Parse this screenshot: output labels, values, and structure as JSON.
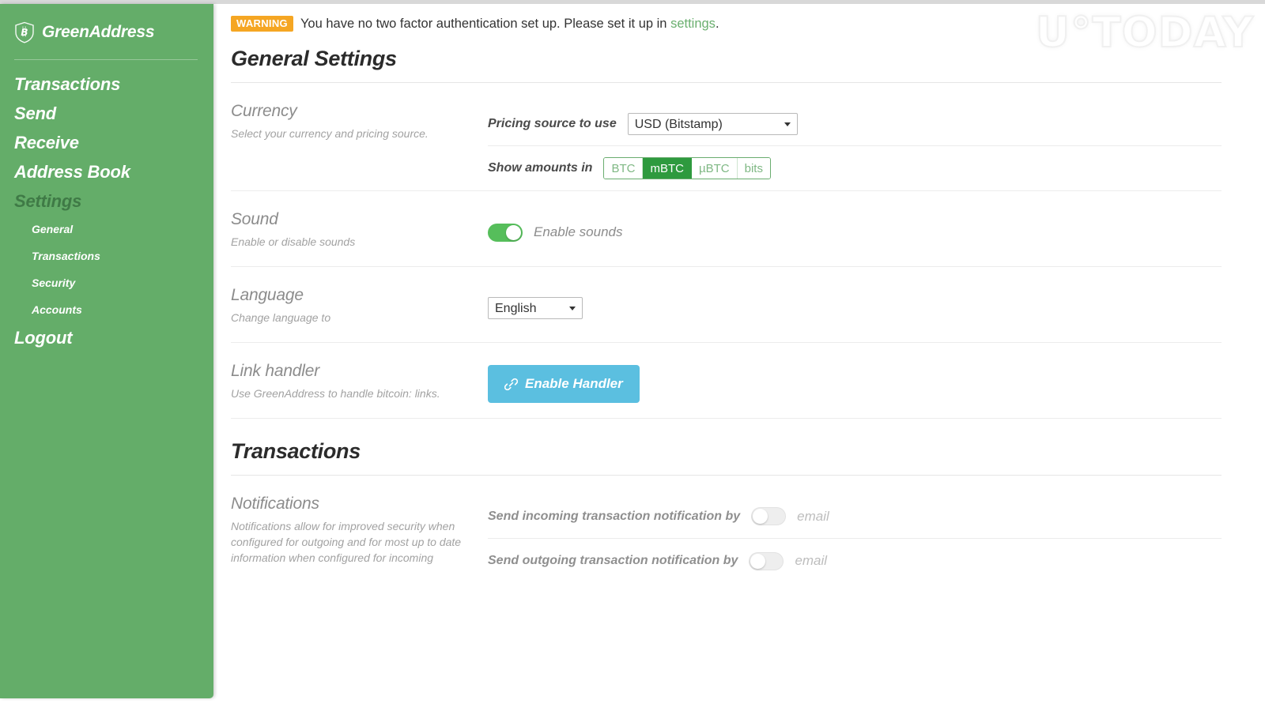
{
  "app": {
    "brand_name": "GreenAddress",
    "brand_icon": "bitcoin-shield-icon",
    "watermark": "U°TODAY"
  },
  "sidebar": {
    "items": [
      {
        "label": "Transactions",
        "icon": "transactions-item",
        "active": false
      },
      {
        "label": "Send",
        "icon": "send-item",
        "active": false
      },
      {
        "label": "Receive",
        "icon": "receive-item",
        "active": false
      },
      {
        "label": "Address Book",
        "icon": "address-book-item",
        "active": false
      },
      {
        "label": "Settings",
        "icon": "settings-item",
        "active": true
      }
    ],
    "sub_items": [
      {
        "label": "General",
        "active": true
      },
      {
        "label": "Transactions",
        "active": false
      },
      {
        "label": "Security",
        "active": false
      },
      {
        "label": "Accounts",
        "active": false
      }
    ],
    "logout_label": "Logout",
    "background_color": "#64ad69"
  },
  "warning": {
    "badge": "WARNING",
    "badge_color": "#f5a623",
    "text_before": "You have no two factor authentication set up. Please set it up in ",
    "link_text": "settings",
    "text_after": ".",
    "link_color": "#6aaf6f"
  },
  "general_settings": {
    "heading": "General Settings",
    "currency": {
      "name": "Currency",
      "description": "Select your currency and pricing source.",
      "pricing_label": "Pricing source to use",
      "pricing_value": "USD (Bitstamp)",
      "pricing_options": [
        "USD (Bitstamp)"
      ],
      "amounts_label": "Show amounts in",
      "units": [
        {
          "label": "BTC",
          "selected": false
        },
        {
          "label": "mBTC",
          "selected": true
        },
        {
          "label": "µBTC",
          "selected": false
        },
        {
          "label": "bits",
          "selected": false
        }
      ],
      "selected_unit_color": "#2e9a3e"
    },
    "sound": {
      "name": "Sound",
      "description": "Enable or disable sounds",
      "toggle_label": "Enable sounds",
      "toggle_on": true,
      "toggle_on_color": "#56be5b"
    },
    "language": {
      "name": "Language",
      "description": "Change language to",
      "value": "English",
      "options": [
        "English"
      ]
    },
    "link_handler": {
      "name": "Link handler",
      "description": "Use GreenAddress to handle bitcoin: links.",
      "button_label": "Enable Handler",
      "button_icon": "chain-link-icon",
      "button_color": "#5bbfe0"
    }
  },
  "transactions_settings": {
    "heading": "Transactions",
    "notifications": {
      "name": "Notifications",
      "description": "Notifications allow for improved security when configured for outgoing and for most up to date information when configured for incoming",
      "incoming_label": "Send incoming transaction notification by",
      "incoming_toggle_label": "email",
      "incoming_toggle_on": false,
      "outgoing_label": "Send outgoing transaction notification by",
      "outgoing_toggle_label": "email",
      "outgoing_toggle_on": false
    }
  }
}
